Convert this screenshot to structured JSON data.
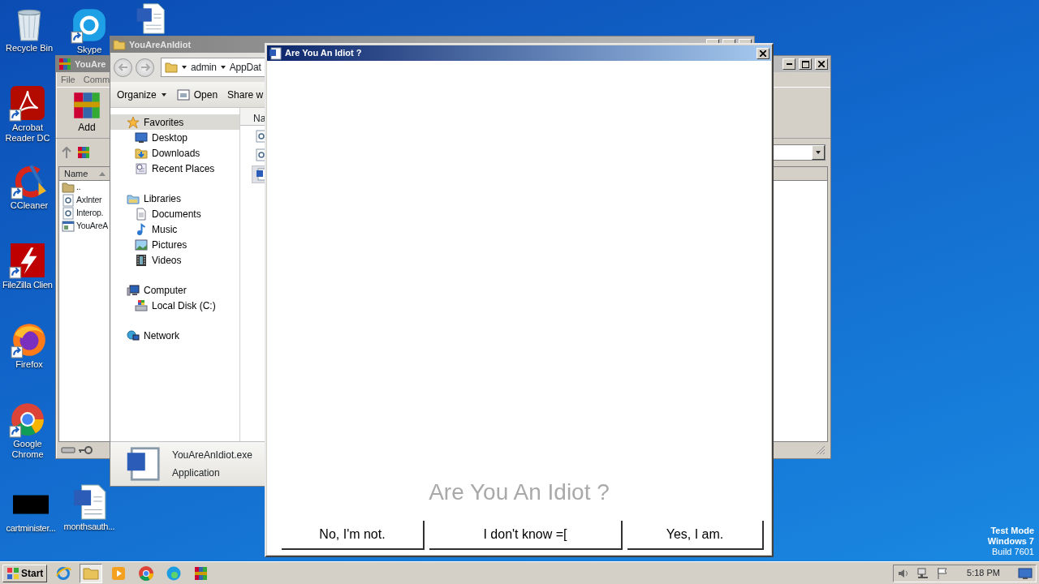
{
  "desktop_icons": [
    {
      "label": "Recycle Bin",
      "kind": "recycle",
      "shortcut": false
    },
    {
      "label": "Skype",
      "kind": "skype",
      "shortcut": true
    },
    {
      "kind": "word",
      "shortcut": false
    },
    {
      "label": "Acrobat Reader DC",
      "kind": "acrobat",
      "shortcut": true
    },
    {
      "label": "CCleaner",
      "kind": "ccleaner",
      "shortcut": true
    },
    {
      "label": "FileZilla Clien",
      "kind": "filezilla",
      "shortcut": true
    },
    {
      "label": "Firefox",
      "kind": "firefox",
      "shortcut": true
    },
    {
      "label": "Google Chrome",
      "kind": "chrome",
      "shortcut": true
    },
    {
      "label": "cartminister...",
      "kind": "black",
      "shortcut": false
    },
    {
      "label": "monthsauth...",
      "kind": "word",
      "shortcut": false
    }
  ],
  "archive_window": {
    "title": "YouAre",
    "menu": [
      "File",
      "Comm"
    ],
    "toolbar": [
      "Add"
    ],
    "column": "Name",
    "files": [
      {
        "name": "..",
        "kind": "parent"
      },
      {
        "name": "AxInter",
        "kind": "component"
      },
      {
        "name": "Interop.",
        "kind": "component"
      },
      {
        "name": "YouAreA",
        "kind": "app"
      }
    ]
  },
  "explorer_window": {
    "title": "YouAreAnIdiot",
    "address": [
      "admin",
      "AppDat"
    ],
    "toolbar": [
      "Organize",
      "Open",
      "Share w"
    ],
    "nav_pane": [
      {
        "label": "Favorites",
        "kind": "star",
        "selected": true,
        "children": [
          {
            "label": "Desktop",
            "kind": "monitor",
            "selected": false
          },
          {
            "label": "Downloads",
            "kind": "downloads",
            "selected": false
          },
          {
            "label": "Recent Places",
            "kind": "recent",
            "selected": false
          }
        ]
      },
      {
        "label": "Libraries",
        "kind": "library",
        "selected": false,
        "children": [
          {
            "label": "Documents",
            "kind": "documents",
            "selected": false
          },
          {
            "label": "Music",
            "kind": "music",
            "selected": false
          },
          {
            "label": "Pictures",
            "kind": "pictures",
            "selected": false
          },
          {
            "label": "Videos",
            "kind": "videos",
            "selected": false
          }
        ]
      },
      {
        "label": "Computer",
        "kind": "computer",
        "selected": false,
        "children": [
          {
            "label": "Local Disk (C:)",
            "kind": "disk",
            "selected": false
          }
        ]
      },
      {
        "label": "Network",
        "kind": "network",
        "selected": false
      }
    ],
    "column": "Na",
    "files": [
      {
        "kind": "component",
        "selected": false
      },
      {
        "kind": "component",
        "selected": false
      },
      {
        "kind": "word",
        "selected": true
      }
    ],
    "details": {
      "name": "YouAreAnIdiot.exe",
      "type": "Application"
    }
  },
  "dialog": {
    "title": "Are You An Idiot ?",
    "caption": "Are You An Idiot ?",
    "buttons": [
      "No, I'm not.",
      "I don't know =[",
      "Yes, I am."
    ]
  },
  "desktop_notice": [
    "Test Mode",
    "Windows 7",
    "Build 7601"
  ],
  "taskbar": {
    "start": "Start",
    "apps": [
      {
        "kind": "ie",
        "active": false
      },
      {
        "kind": "explorer",
        "active": true
      },
      {
        "kind": "media",
        "active": false
      },
      {
        "kind": "chrome",
        "active": false
      },
      {
        "kind": "edge",
        "active": false
      },
      {
        "kind": "winrar",
        "active": false
      }
    ],
    "clock": "5:18 PM"
  }
}
